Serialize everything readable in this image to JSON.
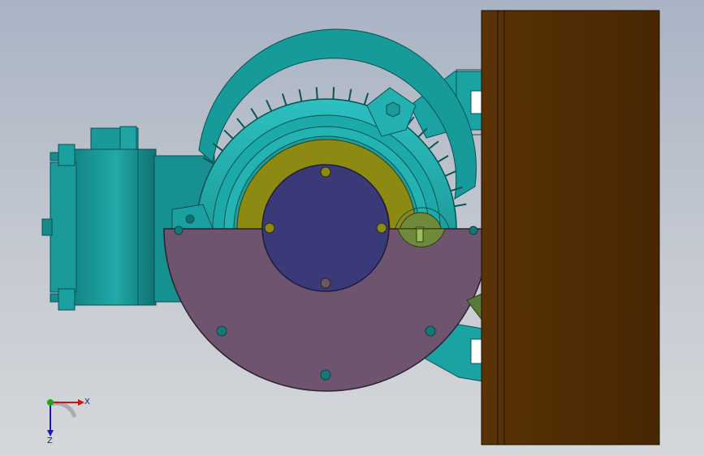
{
  "viewport": {
    "background_top": "#a9b3c4",
    "background_bottom": "#d5d7da"
  },
  "colors": {
    "motor_teal": "#1fa7a7",
    "motor_teal_dark": "#0f6f6f",
    "gear_olive": "#8c8a12",
    "hub_blue": "#3b3a78",
    "guard_mauve": "#6e546f",
    "plate_brown": "#4d2a03",
    "bracket_green": "#5a7a3a"
  },
  "triad": {
    "x_label": "X",
    "z_label": "Z",
    "origin_icon": "axis-origin-icon"
  }
}
